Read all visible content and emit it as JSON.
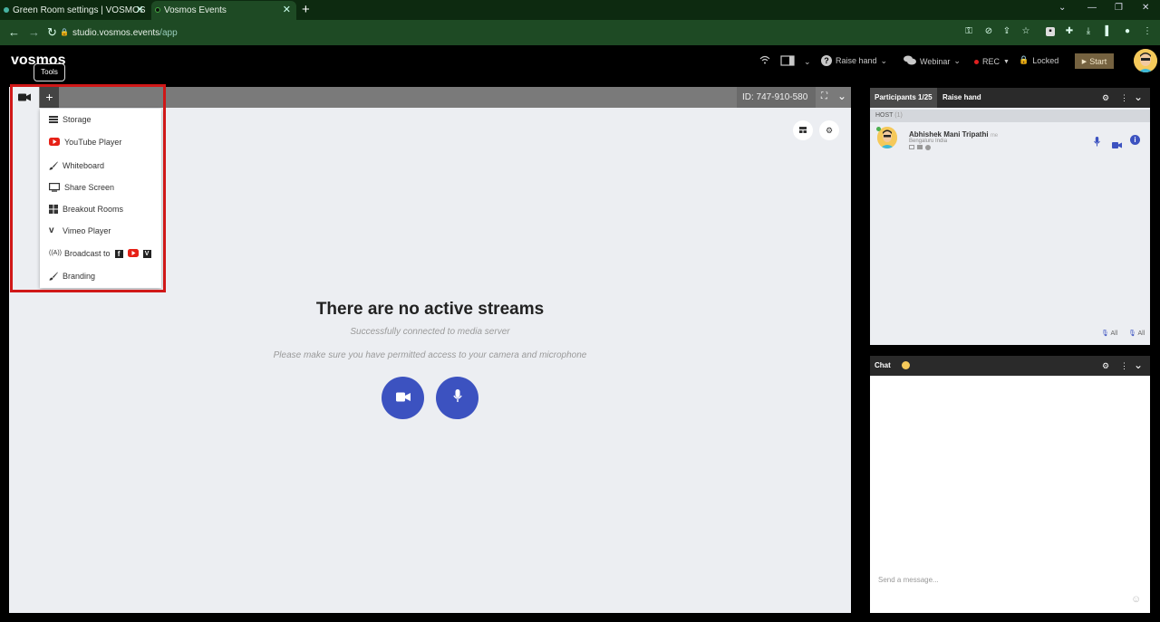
{
  "browser": {
    "tabs": [
      {
        "title": "Green Room settings | VOSMOS",
        "close": "✕"
      },
      {
        "title": "Vosmos Events",
        "close": "✕"
      }
    ],
    "new_tab": "+",
    "url_host": "studio.vosmos.events",
    "url_path": "/app"
  },
  "app": {
    "logo": "vosmos",
    "tooltip": "Tools",
    "topbar": {
      "raise_hand": "Raise hand",
      "webinar": "Webinar",
      "rec": "REC",
      "locked": "Locked",
      "start": "Start"
    }
  },
  "stage": {
    "plus": "+",
    "room_id": "ID: 747-910-580",
    "empty_title": "There are no active streams",
    "empty_sub1": "Successfully connected to media server",
    "empty_sub2": "Please make sure you have permitted access to your camera and microphone"
  },
  "tools_menu": {
    "items": [
      {
        "label": "Storage",
        "icon": "storage-icon"
      },
      {
        "label": "YouTube Player",
        "icon": "youtube-icon"
      },
      {
        "label": "Whiteboard",
        "icon": "brush-icon"
      },
      {
        "label": "Share Screen",
        "icon": "monitor-icon"
      },
      {
        "label": "Breakout Rooms",
        "icon": "grid-icon"
      },
      {
        "label": "Vimeo Player",
        "icon": "vimeo-icon"
      },
      {
        "label": "Broadcast to",
        "icon": "broadcast-icon"
      },
      {
        "label": "Branding",
        "icon": "brush-icon"
      }
    ]
  },
  "participants": {
    "tab_participants": "Participants 1/25",
    "tab_raise_hand": "Raise hand",
    "host_label": "HOST",
    "host_count": "(1)",
    "person_name": "Abhishek Mani Tripathi",
    "person_me": "me",
    "person_location": "Bengaluru India",
    "all_label_1": "All",
    "all_label_2": "All"
  },
  "chat": {
    "title": "Chat",
    "placeholder": "Send a message..."
  },
  "colors": {
    "accent_blue": "#3c52c0",
    "highlight_red": "#d01818",
    "start_button": "#756240"
  }
}
